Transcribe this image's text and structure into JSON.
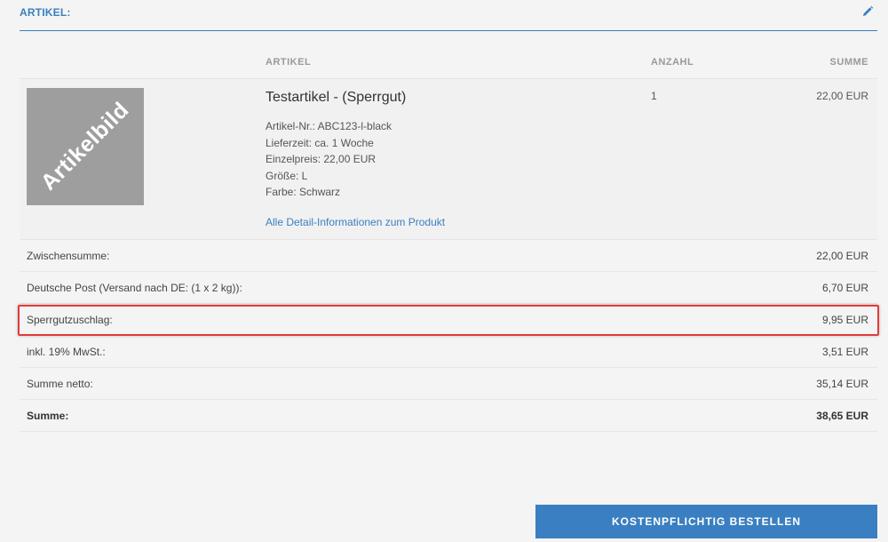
{
  "section": {
    "title": "ARTIKEL:",
    "edit_icon": "pencil-icon"
  },
  "table": {
    "columns": {
      "artikel": "ARTIKEL",
      "anzahl": "ANZAHL",
      "summe": "SUMME"
    }
  },
  "product": {
    "image_text": "Artikelbild",
    "name": "Testartikel - (Sperrgut)",
    "details": [
      "Artikel-Nr.: ABC123-l-black",
      "Lieferzeit: ca. 1 Woche",
      "Einzelpreis: 22,00 EUR",
      "Größe: L",
      "Farbe: Schwarz"
    ],
    "link": "Alle Detail-Informationen zum Produkt",
    "quantity": "1",
    "sum": "22,00 EUR"
  },
  "totals": [
    {
      "label": "Zwischensumme:",
      "value": "22,00 EUR"
    },
    {
      "label": "Deutsche Post (Versand nach DE: (1 x 2 kg)):",
      "value": "6,70 EUR"
    },
    {
      "label": "Sperrgutzuschlag:",
      "value": "9,95 EUR"
    },
    {
      "label": "inkl. 19% MwSt.:",
      "value": "3,51 EUR"
    },
    {
      "label": "Summe netto:",
      "value": "35,14 EUR"
    },
    {
      "label": "Summe:",
      "value": "38,65 EUR"
    }
  ],
  "order_button": "KOSTENPFLICHTIG BESTELLEN",
  "colors": {
    "accent": "#3a7fc1",
    "highlight": "#e23a3a"
  }
}
